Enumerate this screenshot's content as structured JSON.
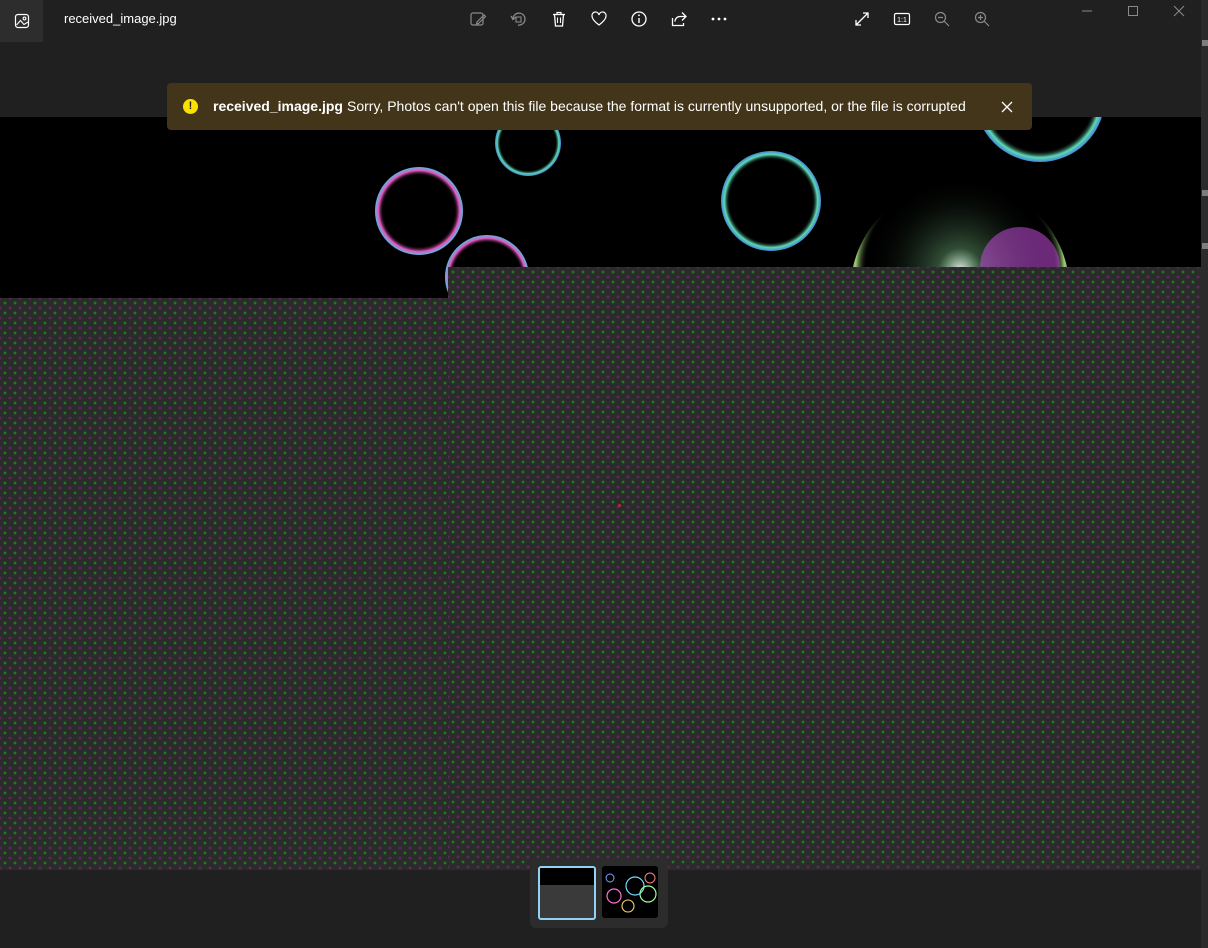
{
  "window": {
    "title": "received_image.jpg"
  },
  "toolbar": {
    "items": [
      {
        "name": "edit-image-icon"
      },
      {
        "name": "rotate-icon"
      },
      {
        "name": "delete-icon"
      },
      {
        "name": "favorite-heart-icon"
      },
      {
        "name": "info-icon"
      },
      {
        "name": "share-icon"
      },
      {
        "name": "more-options-icon"
      },
      {
        "name": "full-screen-icon"
      },
      {
        "name": "actual-size-icon",
        "label": "1:1"
      },
      {
        "name": "zoom-out-icon"
      },
      {
        "name": "zoom-in-icon"
      }
    ]
  },
  "window_controls": [
    "minimize",
    "maximize",
    "close"
  ],
  "notification": {
    "filename": "received_image.jpg",
    "message": "Sorry, Photos can't open this file because the format is currently unsupported, or the file is corrupted",
    "icon": "warning-icon",
    "colors": {
      "background": "#433519",
      "icon": "#fce100"
    }
  },
  "filmstrip": {
    "items": [
      {
        "name": "filmstrip-thumbnail-current",
        "selected": true
      },
      {
        "name": "filmstrip-thumbnail-bubbles",
        "selected": false
      }
    ],
    "accent": "#8fd3f5"
  }
}
